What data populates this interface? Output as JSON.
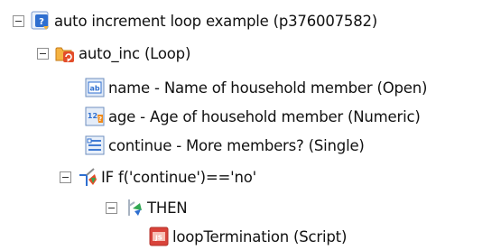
{
  "tree": {
    "root": {
      "label": "auto increment loop example (p376007582)",
      "icon": "survey-document-icon"
    },
    "loop": {
      "label": "auto_inc (Loop)",
      "icon": "loop-folder-icon"
    },
    "questions": [
      {
        "label": "name - Name of household member (Open)",
        "icon": "open-text-question-icon"
      },
      {
        "label": "age - Age of household member (Numeric)",
        "icon": "numeric-question-icon"
      },
      {
        "label": "continue - More members? (Single)",
        "icon": "single-choice-question-icon"
      }
    ],
    "condition": {
      "label": "IF f('continue')=='no'",
      "icon": "condition-if-icon"
    },
    "then": {
      "label": "THEN",
      "icon": "condition-then-icon"
    },
    "script": {
      "label": "loopTermination (Script)",
      "icon": "script-icon"
    }
  },
  "colors": {
    "expander_border": "#8f8f8f",
    "survey_blue": "#2f6fd0",
    "loop_orange": "#f08a1a",
    "script_red": "#d9433a"
  }
}
